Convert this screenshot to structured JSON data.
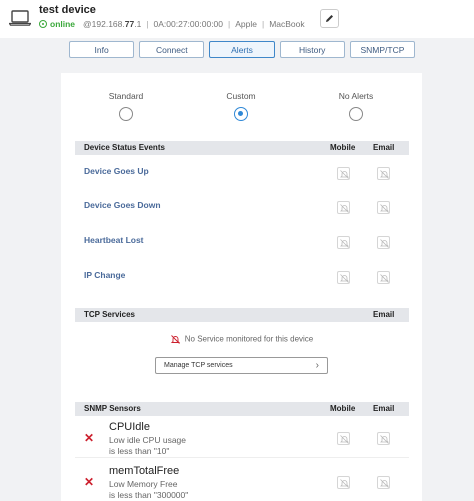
{
  "device": {
    "title": "test device",
    "status": "online",
    "ip_prefix": "@192.168.",
    "ip_bold": "77",
    "ip_suffix": ".1",
    "mac": "0A:00:27:00:00:00",
    "vendor": "Apple",
    "model": "MacBook"
  },
  "tabs": [
    {
      "label": "Info",
      "active": false
    },
    {
      "label": "Connect",
      "active": false
    },
    {
      "label": "Alerts",
      "active": true
    },
    {
      "label": "History",
      "active": false
    },
    {
      "label": "SNMP/TCP",
      "active": false
    }
  ],
  "alert_modes": {
    "options": [
      "Standard",
      "Custom",
      "No Alerts"
    ],
    "selected": "Custom"
  },
  "device_status": {
    "header": "Device Status Events",
    "col_mobile": "Mobile",
    "col_email": "Email",
    "events": [
      "Device Goes Up",
      "Device Goes Down",
      "Heartbeat Lost",
      "IP Change"
    ]
  },
  "tcp": {
    "header": "TCP Services",
    "col_email": "Email",
    "empty_text": "No Service monitored for this device",
    "manage_label": "Manage TCP services"
  },
  "snmp": {
    "header": "SNMP Sensors",
    "col_mobile": "Mobile",
    "col_email": "Email",
    "sensors": [
      {
        "name": "CPUIdle",
        "desc1": "Low idle CPU usage",
        "desc2": "is less than \"10\""
      },
      {
        "name": "memTotalFree",
        "desc1": "Low Memory Free",
        "desc2": "is less than \"300000\""
      }
    ]
  },
  "colors": {
    "accent": "#2f88d6",
    "online": "#3aa83a",
    "error": "#cc1f2d",
    "event_label": "#4a6a9a"
  }
}
